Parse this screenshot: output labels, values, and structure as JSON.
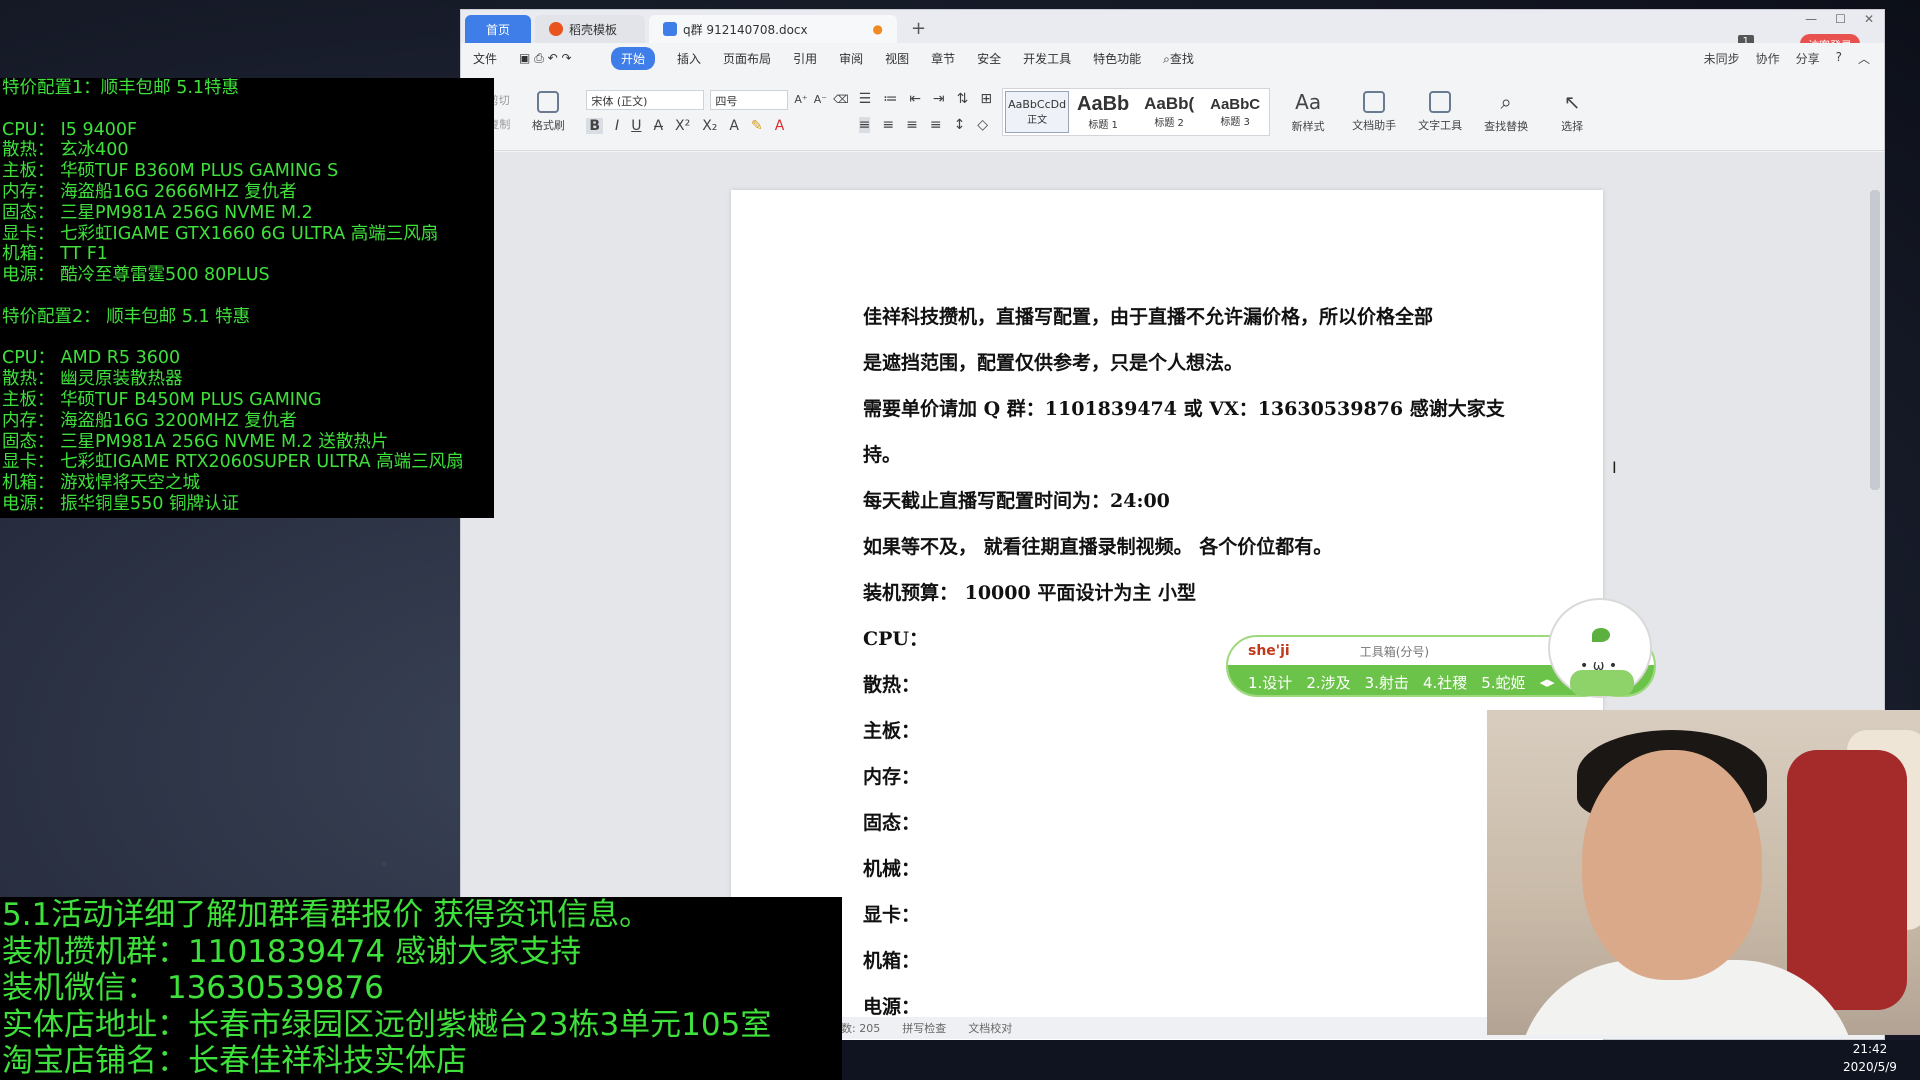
{
  "wps": {
    "tabs": [
      "首页",
      "稻壳模板",
      "q群 912140708.docx"
    ],
    "visitor_label": "访客登录",
    "window_badge": "1",
    "menu": [
      "文件",
      "开始",
      "插入",
      "页面布局",
      "引用",
      "审阅",
      "视图",
      "章节",
      "安全",
      "开发工具",
      "特色功能",
      "查找"
    ],
    "menu_right": [
      "未同步",
      "协作",
      "分享"
    ],
    "ribbon": {
      "font_name": "宋体 (正文)",
      "font_size": "四号",
      "format_painter": "格式刷",
      "cut": "剪切",
      "copy": "复制",
      "styles": [
        {
          "sample": "AaBbCcDd",
          "label": "正文"
        },
        {
          "sample": "AaBb",
          "label": "标题 1"
        },
        {
          "sample": "AaBb(",
          "label": "标题 2"
        },
        {
          "sample": "AaBbC",
          "label": "标题 3"
        }
      ],
      "tools": [
        "新样式",
        "文档助手",
        "文字工具",
        "查找替换",
        "选择"
      ]
    },
    "document_lines": [
      "佳祥科技攒机，直播写配置，由于直播不允许漏价格，所以价格全部",
      "是遮挡范围，配置仅供参考，只是个人想法。",
      "需要单价请加 Q 群：1101839474  或 VX：13630539876  感谢大家支",
      "持。",
      "每天截止直播写配置时间为：24:00",
      "如果等不及，  就看往期直播录制视频。 各个价位都有。",
      "装机预算：  10000    平面设计为主  小型",
      "CPU：",
      "散热：",
      "主板：",
      "内存：",
      "固态：",
      "机械：",
      "显卡：",
      "机箱：",
      "电源："
    ],
    "status": [
      "数: 205",
      "拼写检查",
      "文档校对"
    ]
  },
  "ime": {
    "typed": "she'ji",
    "toolbox": "工具箱(分号)",
    "candidates": [
      "1.设计",
      "2.涉及",
      "3.射击",
      "4.社稷",
      "5.蛇姬"
    ]
  },
  "overlay_top": [
    "特价配置1：顺丰包邮  5.1特惠",
    "",
    "CPU：  I5 9400F",
    "散热：  玄冰400",
    "主板：  华硕TUF B360M PLUS GAMING S",
    "内存：  海盗船16G 2666MHZ 复仇者",
    "固态：  三星PM981A 256G NVME M.2",
    "显卡：  七彩虹IGAME GTX1660 6G ULTRA 高端三风扇",
    "机箱：  TT F1",
    "电源：  酷冷至尊雷霆500 80PLUS",
    "",
    "特价配置2：  顺丰包邮  5.1 特惠",
    "",
    "CPU：  AMD R5 3600",
    "散热：  幽灵原装散热器",
    "主板：  华硕TUF B450M PLUS GAMING",
    "内存：  海盗船16G 3200MHZ 复仇者",
    "固态：  三星PM981A 256G NVME M.2 送散热片",
    "显卡：  七彩虹IGAME RTX2060SUPER ULTRA 高端三风扇",
    "机箱：  游戏悍将天空之城",
    "电源：  振华铜皇550 铜牌认证"
  ],
  "overlay_bottom": [
    "5.1活动详细了解加群看群报价 获得资讯信息。",
    "装机攒机群：1101839474  感谢大家支持",
    "装机微信：  13630539876",
    "实体店地址：长春市绿园区远创紫樾台23栋3单元105室",
    "淘宝店铺名：长春佳祥科技实体店"
  ],
  "clock": {
    "time": "21:42",
    "date": "2020/5/9"
  },
  "colors": {
    "overlay_text": "#3fe03b",
    "accent": "#3f7ee8",
    "ime_green": "#6cc34a"
  }
}
